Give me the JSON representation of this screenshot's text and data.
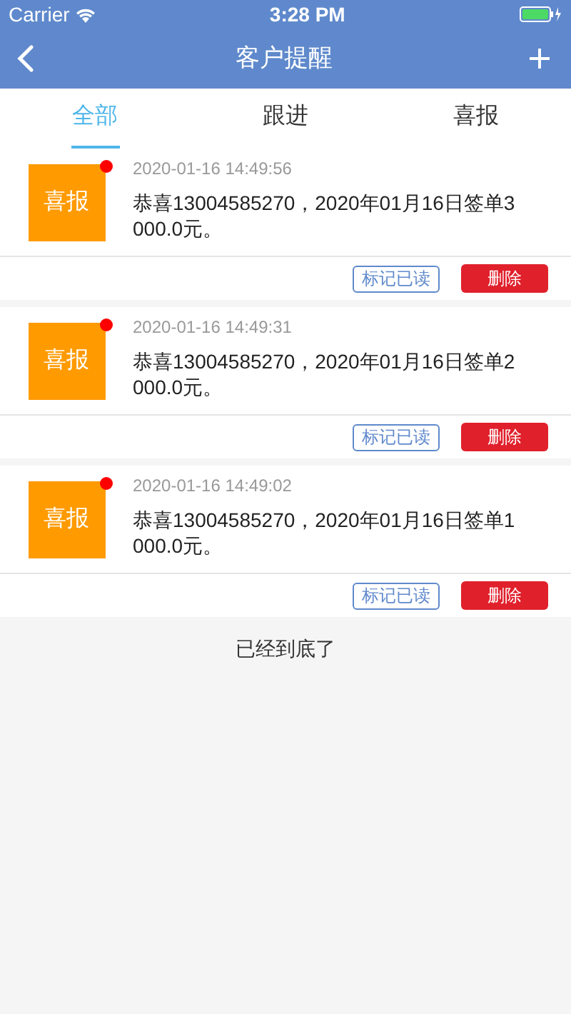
{
  "status_bar": {
    "carrier": "Carrier",
    "time": "3:28 PM"
  },
  "nav": {
    "title": "客户提醒"
  },
  "tabs": [
    {
      "label": "全部",
      "selected": true
    },
    {
      "label": "跟进",
      "selected": false
    },
    {
      "label": "喜报",
      "selected": false
    }
  ],
  "items": [
    {
      "badge": "喜报",
      "unread": true,
      "time": "2020-01-16 14:49:56",
      "message": "恭喜13004585270，2020年01月16日签单3000.0元。",
      "mark_read": "标记已读",
      "delete": "删除"
    },
    {
      "badge": "喜报",
      "unread": true,
      "time": "2020-01-16 14:49:31",
      "message": "恭喜13004585270，2020年01月16日签单2000.0元。",
      "mark_read": "标记已读",
      "delete": "删除"
    },
    {
      "badge": "喜报",
      "unread": true,
      "time": "2020-01-16 14:49:02",
      "message": "恭喜13004585270，2020年01月16日签单1000.0元。",
      "mark_read": "标记已读",
      "delete": "删除"
    }
  ],
  "footer": "已经到底了"
}
